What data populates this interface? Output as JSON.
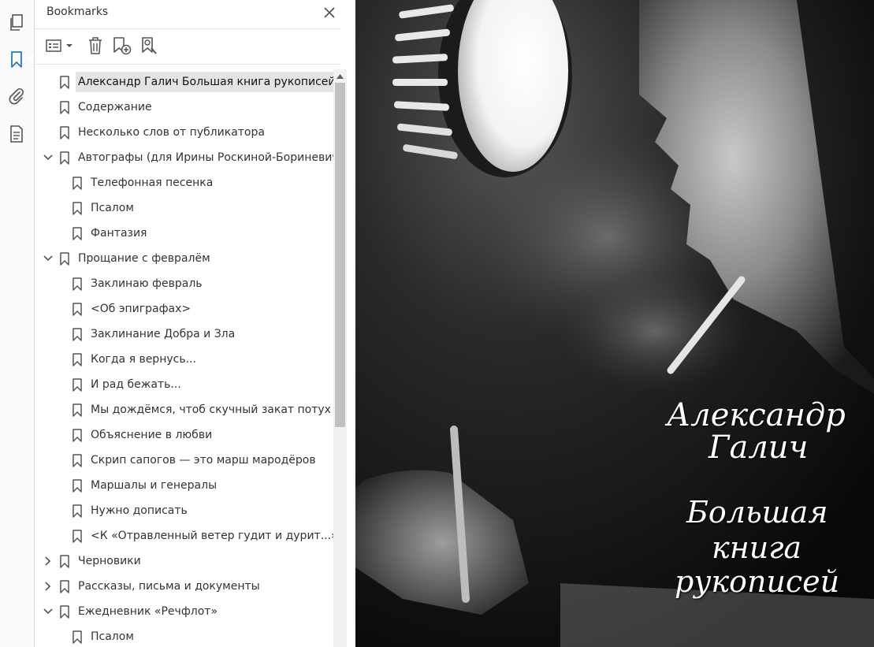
{
  "panel": {
    "title": "Bookmarks"
  },
  "rail": {
    "icons": [
      "pages-icon",
      "bookmark-icon",
      "attachment-icon",
      "document-icon"
    ]
  },
  "toolbar": {
    "options": "options-menu",
    "delete": "delete-bookmark",
    "add": "add-bookmark",
    "find": "find-bookmark"
  },
  "bookmarks": [
    {
      "label": "Александр Галич Большая книга рукописей",
      "level": 0,
      "expander": "none",
      "selected": true
    },
    {
      "label": "Содержание",
      "level": 0,
      "expander": "none"
    },
    {
      "label": "Несколько слов от публикатора",
      "level": 0,
      "expander": "none"
    },
    {
      "label": "Автографы (для Ирины Роскиной-Бориневич)",
      "level": 0,
      "expander": "expanded"
    },
    {
      "label": "Телефонная песенка",
      "level": 1,
      "expander": "none"
    },
    {
      "label": "Псалом",
      "level": 1,
      "expander": "none"
    },
    {
      "label": "Фантазия",
      "level": 1,
      "expander": "none"
    },
    {
      "label": "Прощание с февралём",
      "level": 0,
      "expander": "expanded"
    },
    {
      "label": "Заклинаю февраль",
      "level": 1,
      "expander": "none"
    },
    {
      "label": "<Об эпиграфах>",
      "level": 1,
      "expander": "none"
    },
    {
      "label": "Заклинание Добра и Зла",
      "level": 1,
      "expander": "none"
    },
    {
      "label": "Когда я вернусь...",
      "level": 1,
      "expander": "none"
    },
    {
      "label": "И рад бежать...",
      "level": 1,
      "expander": "none"
    },
    {
      "label": "Мы дождёмся, чтоб скучный закат потух",
      "level": 1,
      "expander": "none"
    },
    {
      "label": "Объяснение в любви",
      "level": 1,
      "expander": "none"
    },
    {
      "label": "Скрип сапогов — это марш мародёров",
      "level": 1,
      "expander": "none"
    },
    {
      "label": "Маршалы и генералы",
      "level": 1,
      "expander": "none"
    },
    {
      "label": "Нужно дописать",
      "level": 1,
      "expander": "none"
    },
    {
      "label": "<К «Отравленный ветер гудит и дурит...»>",
      "level": 1,
      "expander": "none"
    },
    {
      "label": "Черновики",
      "level": 0,
      "expander": "collapsed"
    },
    {
      "label": "Рассказы, письма и документы",
      "level": 0,
      "expander": "collapsed"
    },
    {
      "label": "Ежедневник «Речфлот»",
      "level": 0,
      "expander": "expanded"
    },
    {
      "label": "Псалом",
      "level": 1,
      "expander": "none"
    }
  ],
  "cover": {
    "author_first": "Александр",
    "author_last": "Галич",
    "title_1": "Большая",
    "title_2": "книга",
    "title_3": "рукописей"
  },
  "colors": {
    "accent": "#2b74c7",
    "selection": "#e4e4e4",
    "icon": "#555555"
  }
}
